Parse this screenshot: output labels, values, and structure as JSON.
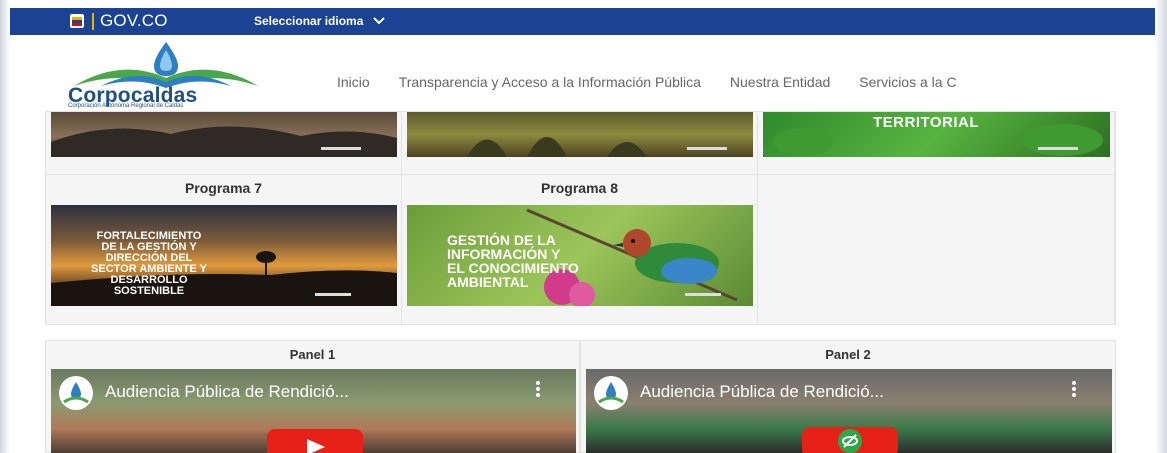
{
  "gov_bar": {
    "logo_text": "GOV.CO",
    "language_label": "Seleccionar idioma"
  },
  "header": {
    "logo_title": "Corpocaldas",
    "logo_subtitle": "Corporación Autónoma Regional de Caldas",
    "nav": [
      {
        "label": "Inicio"
      },
      {
        "label": "Transparencia y Acceso a la Información Pública"
      },
      {
        "label": "Nuestra Entidad"
      },
      {
        "label": "Servicios a la C"
      }
    ]
  },
  "programs": {
    "top_row_banner_3_text": "TERRITORIAL",
    "program_7": {
      "title": "Programa 7",
      "banner_lines": [
        "FORTALECIMIENTO",
        "DE LA GESTIÓN Y",
        "DIRECCIÓN DEL",
        "SECTOR AMBIENTE Y",
        "DESARROLLO",
        "SOSTENIBLE"
      ]
    },
    "program_8": {
      "title": "Programa 8",
      "banner_lines": [
        "GESTIÓN DE LA",
        "INFORMACIÓN Y",
        "EL CONOCIMIENTO",
        "AMBIENTAL"
      ]
    }
  },
  "panels": [
    {
      "title": "Panel 1",
      "video_title": "Audiencia Pública de Rendició..."
    },
    {
      "title": "Panel 2",
      "video_title": "Audiencia Pública de Rendició..."
    }
  ],
  "colors": {
    "gov_bar": "#1c4293",
    "youtube_red": "#e62117",
    "brand_blue": "#1f4f86",
    "brand_green": "#4aa84a"
  }
}
